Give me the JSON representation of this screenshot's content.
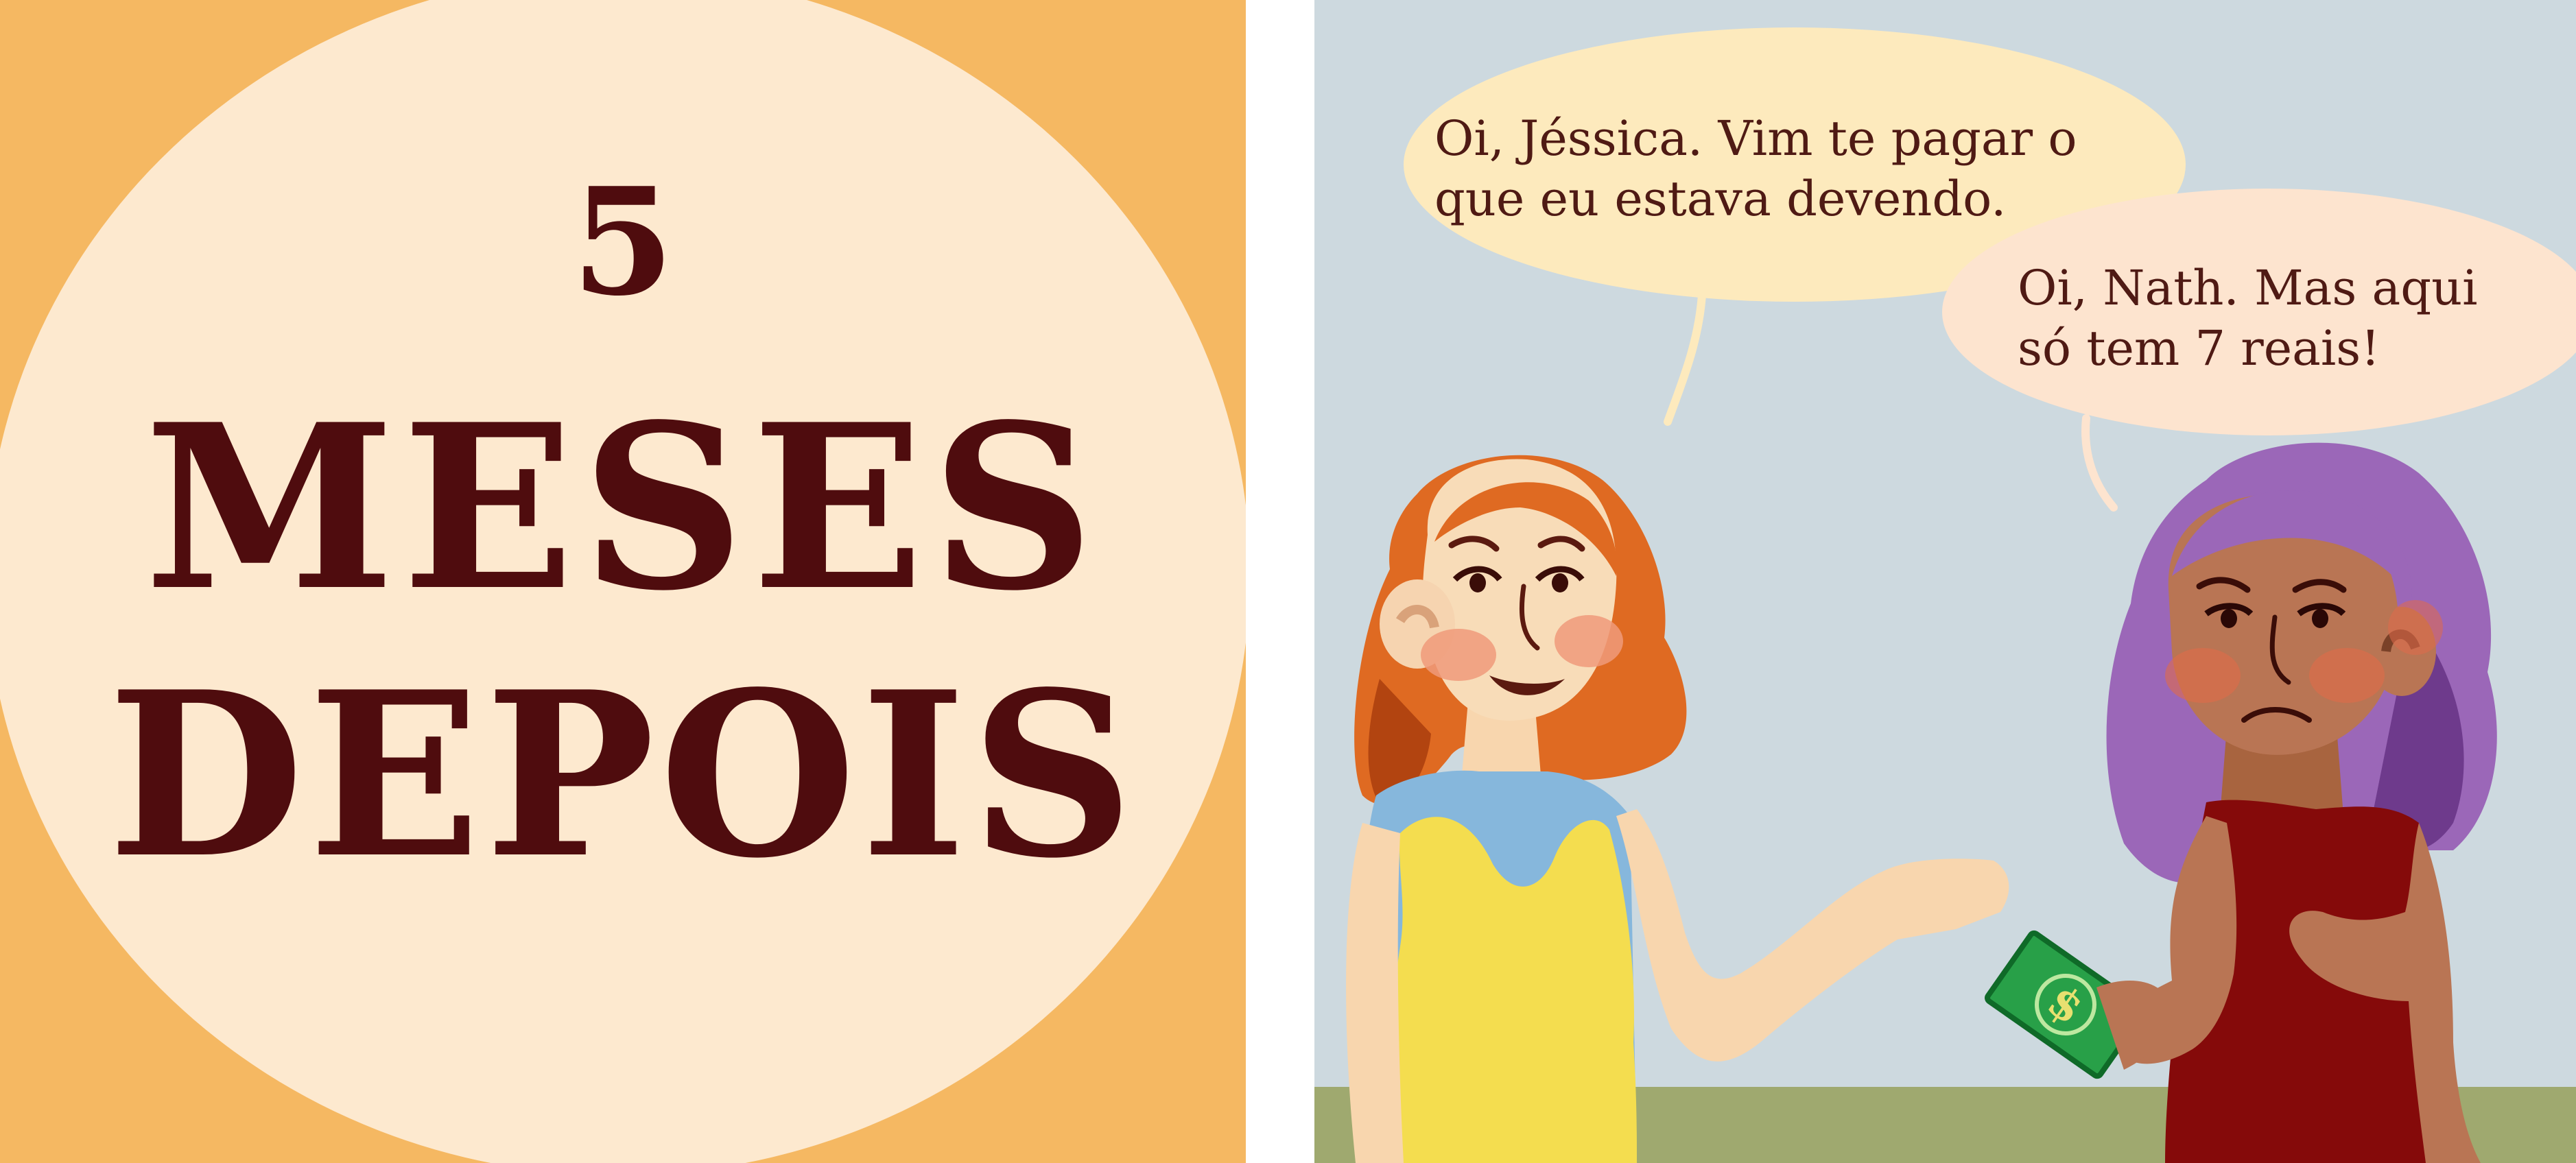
{
  "left_panel": {
    "caption_number": "5",
    "caption_line1": "MESES",
    "caption_line2": "DEPOIS"
  },
  "right_panel": {
    "speech_nath": {
      "line1": "Oi, Jéssica. Vim te pagar o",
      "line2": "que eu estava devendo."
    },
    "speech_jessica": {
      "line1": "Oi, Nath. Mas aqui",
      "line2": "só tem 7 reais!"
    },
    "money_symbol": "$"
  },
  "colors": {
    "left_bg": "#f5b862",
    "circle": "#fde9cf",
    "caption_text": "#4f0c0e",
    "sky": "#cdd9df",
    "ground": "#9fa96f",
    "bubble_yellow": "#fdeabd",
    "bubble_peach": "#fde4cf",
    "nath_hair": "#df6a22",
    "nath_dress": "#f4dd4f",
    "nath_shirt": "#86b7dc",
    "jessica_hair": "#9b67b8",
    "jessica_dress": "#850a0a",
    "jessica_skin": "#b97554",
    "bill": "#28a048"
  }
}
